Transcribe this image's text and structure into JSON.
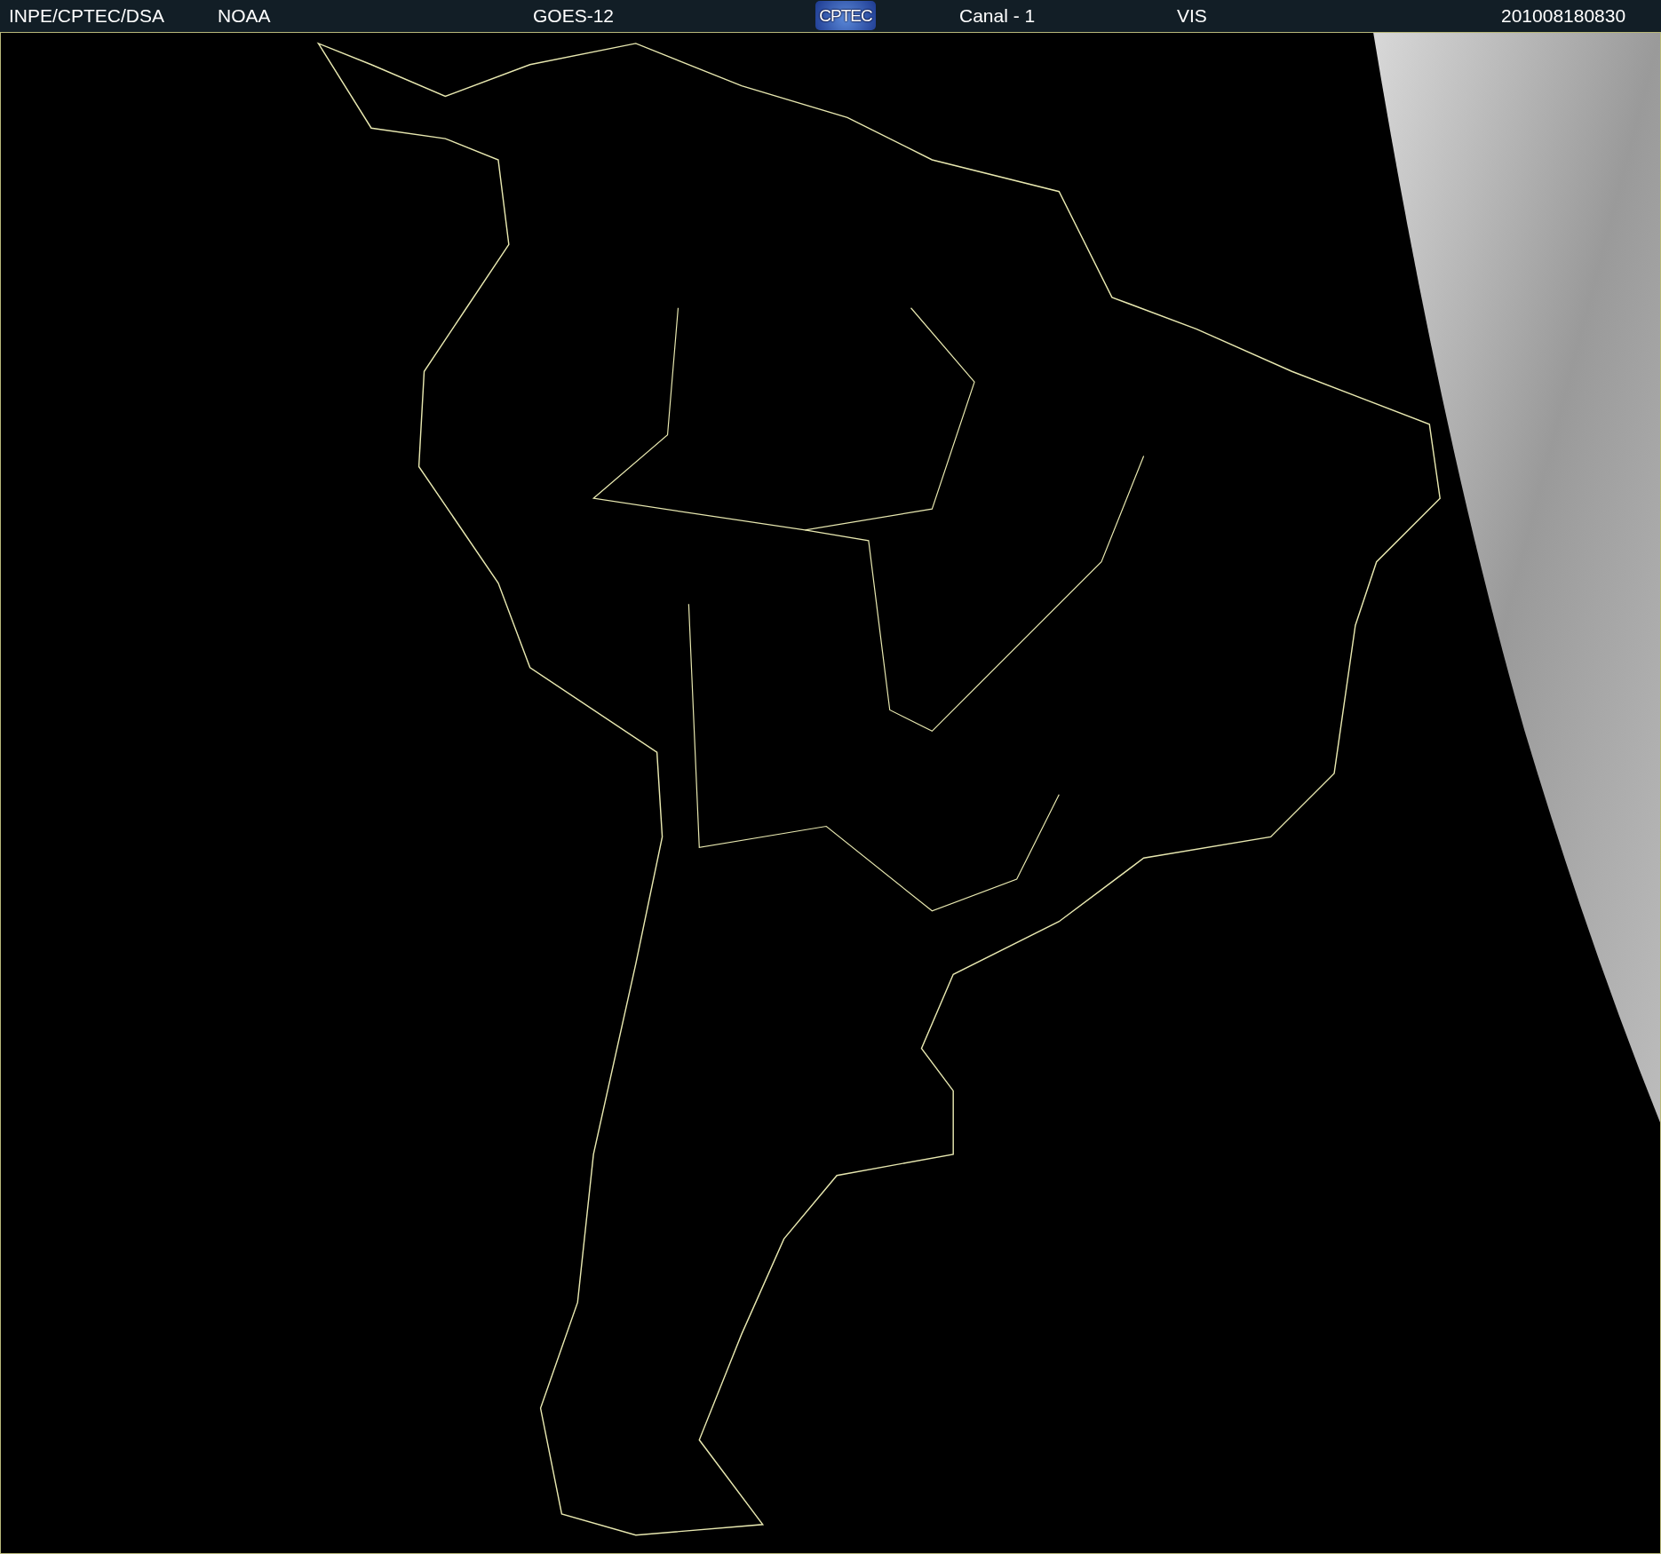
{
  "header": {
    "items": [
      {
        "kind": "text",
        "text": "INPE/CPTEC/DSA"
      },
      {
        "kind": "text",
        "text": "NOAA"
      },
      {
        "kind": "text",
        "text": "GOES-12"
      },
      {
        "kind": "logo",
        "text": "CPTEC"
      },
      {
        "kind": "text",
        "text": "Canal - 1"
      },
      {
        "kind": "text",
        "text": "VIS"
      },
      {
        "kind": "text",
        "text": "201008180830"
      }
    ]
  }
}
